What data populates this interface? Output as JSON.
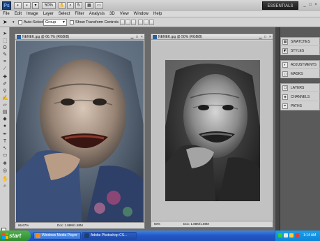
{
  "app": {
    "logo_text": "Ps",
    "zoom_label": "50%",
    "workspace_label": "ESSENTIALS",
    "window_controls": [
      "_",
      "□",
      "×"
    ]
  },
  "menu": [
    "File",
    "Edit",
    "Image",
    "Layer",
    "Select",
    "Filter",
    "Analysis",
    "3D",
    "View",
    "Window",
    "Help"
  ],
  "options_bar": {
    "auto_select_label": "Auto-Select:",
    "auto_select_value": "Group",
    "show_transform_label": "Show Transform Controls"
  },
  "documents": [
    {
      "title": "NENEK.jpg @ 66.7% (RGB/8)",
      "zoom": "66.67%",
      "doc_info": "Doc: 1.88M/1.88M"
    },
    {
      "title": "NENEK.jpg @ 50% (RGB/8)",
      "zoom": "50%",
      "doc_info": "Doc: 1.88M/1.88M"
    }
  ],
  "panels": {
    "group1": [
      "SWATCHES",
      "STYLES"
    ],
    "group2": [
      "ADJUSTMENTS",
      "MASKS"
    ],
    "group3": [
      "LAYERS",
      "CHANNELS",
      "PATHS"
    ]
  },
  "taskbar": {
    "start_label": "start",
    "tasks": [
      "Windows Media Player",
      "Adobe Photoshop CS..."
    ],
    "clock": "1:14 AM"
  }
}
